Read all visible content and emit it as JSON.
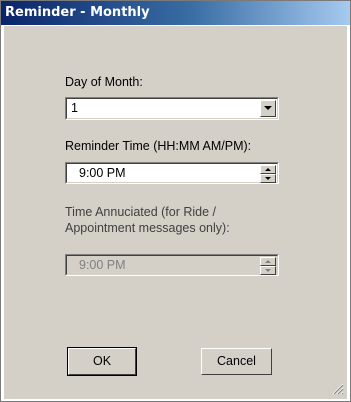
{
  "window": {
    "title": "Reminder - Monthly"
  },
  "day_of_month": {
    "label": "Day of Month:",
    "value": "1"
  },
  "reminder_time": {
    "label": "Reminder Time (HH:MM   AM/PM):",
    "value": "9:00 PM"
  },
  "time_annunciated": {
    "label_line1": "Time Annuciated (for Ride /",
    "label_line2": "Appointment messages only):",
    "value": "9:00 PM",
    "enabled": false
  },
  "buttons": {
    "ok_label": "OK",
    "cancel_label": "Cancel"
  },
  "icons": {
    "combo_arrow": "chevron-down-icon",
    "spin_up": "spin-up-icon",
    "spin_down": "spin-down-icon",
    "size_grip": "resize-grip-icon"
  },
  "colors": {
    "title_gradient_start": "#0a246a",
    "title_gradient_end": "#a6caf0",
    "dialog_face": "#d4d0c8",
    "disabled_text": "#808080"
  }
}
